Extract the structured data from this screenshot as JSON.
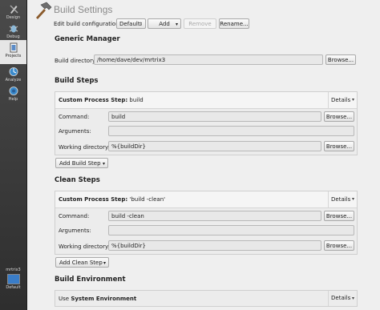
{
  "modebar": {
    "items": [
      {
        "label": "Design"
      },
      {
        "label": "Debug"
      },
      {
        "label": "Projects"
      },
      {
        "label": "Analyze"
      },
      {
        "label": "Help"
      }
    ],
    "kit_name": "mrtrix3",
    "kit_config": "Default"
  },
  "header": {
    "title": "Build Settings",
    "config_label": "Edit build configuration:",
    "config_value": "Default",
    "add_label": "Add",
    "remove_label": "Remove",
    "rename_label": "Rename..."
  },
  "generic_manager": {
    "heading": "Generic Manager",
    "build_dir_label": "Build directory:",
    "build_dir_value": "/home/dave/dev/mrtrix3",
    "browse_label": "Browse..."
  },
  "build_steps": {
    "heading": "Build Steps",
    "step_title": "Custom Process Step:",
    "step_value": "build",
    "details_label": "Details",
    "command_label": "Command:",
    "command_value": "build",
    "arguments_label": "Arguments:",
    "arguments_value": "",
    "workdir_label": "Working directory:",
    "workdir_value": "%{buildDir}",
    "browse_label": "Browse...",
    "add_step_label": "Add Build Step"
  },
  "clean_steps": {
    "heading": "Clean Steps",
    "step_title": "Custom Process Step:",
    "step_value": "'build -clean'",
    "details_label": "Details",
    "command_label": "Command:",
    "command_value": "build -clean",
    "arguments_label": "Arguments:",
    "arguments_value": "",
    "workdir_label": "Working directory:",
    "workdir_value": "%{buildDir}",
    "browse_label": "Browse...",
    "add_step_label": "Add Clean Step"
  },
  "build_environment": {
    "heading": "Build Environment",
    "use_label": "Use",
    "env_name": "System Environment",
    "details_label": "Details"
  }
}
